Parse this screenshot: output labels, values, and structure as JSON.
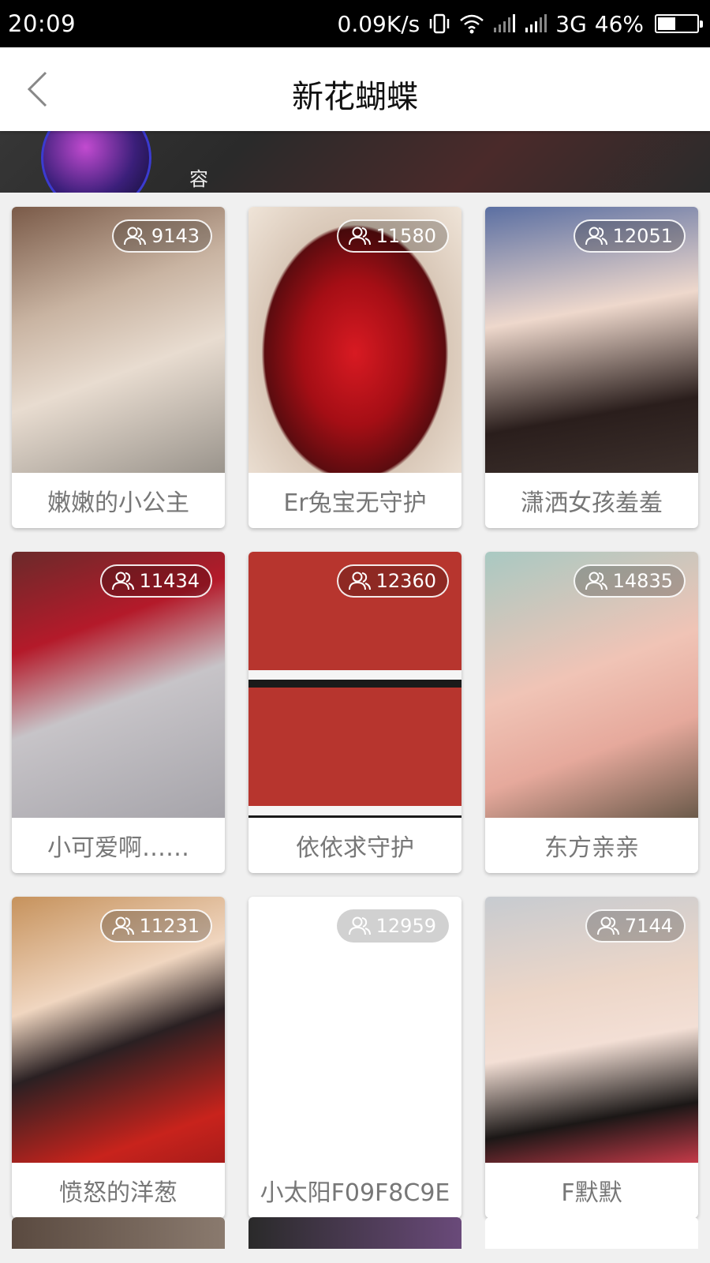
{
  "status_bar": {
    "time": "20:09",
    "speed": "0.09K/s",
    "network": "3G",
    "battery": "46%",
    "battery_level": 0.46
  },
  "banner": {
    "text_line": "容"
  },
  "nav": {
    "title": "新花蝴蝶"
  },
  "streams": [
    {
      "name": "嫩嫩的小公主",
      "viewers": "9143"
    },
    {
      "name": "Er兔宝无守护",
      "viewers": "11580"
    },
    {
      "name": "潇洒女孩羞羞",
      "viewers": "12051"
    },
    {
      "name": "小可爱啊……",
      "viewers": "11434"
    },
    {
      "name": "依依求守护",
      "viewers": "12360"
    },
    {
      "name": "东方亲亲",
      "viewers": "14835"
    },
    {
      "name": "愤怒的洋葱",
      "viewers": "11231"
    },
    {
      "name": "小太阳F09F8C9E",
      "viewers": "12959"
    },
    {
      "name": "F默默",
      "viewers": "7144"
    }
  ],
  "icons": {
    "back": "chevron-left-icon",
    "viewers": "users-icon",
    "vibrate": "vibrate-icon",
    "wifi": "wifi-icon",
    "signal": "signal-icon",
    "battery": "battery-icon"
  }
}
